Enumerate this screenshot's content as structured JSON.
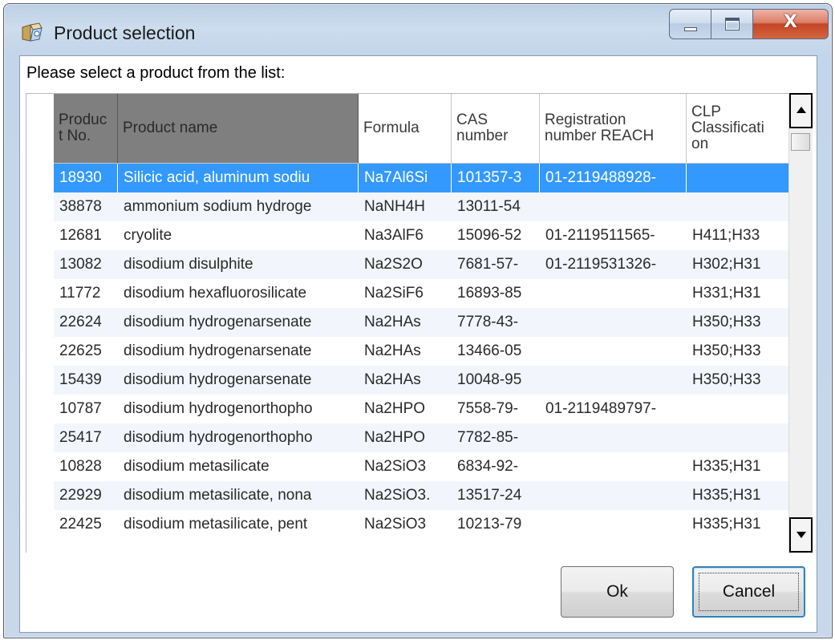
{
  "window": {
    "title": "Product selection",
    "icon": "app-icon",
    "caption": {
      "minimize_icon": "minimize-icon",
      "maximize_icon": "maximize-icon",
      "close_glyph": "X"
    }
  },
  "prompt": "Please select a product from the list:",
  "grid": {
    "columns": [
      "Product No.",
      "Product name",
      "Formula",
      "CAS number",
      "Registration number REACH",
      "CLP Classification"
    ],
    "header_display": [
      [
        "Produc",
        "t No."
      ],
      [
        "Product name"
      ],
      [
        "Formula"
      ],
      [
        "CAS",
        "number"
      ],
      [
        "Registration",
        "number REACH"
      ],
      [
        "CLP",
        "Classificati",
        "on"
      ]
    ],
    "selected_row": 0,
    "rows": [
      [
        "18930",
        "Silicic acid, aluminum sodiu",
        "Na7Al6Si",
        "101357-3",
        "01-2119488928-",
        ""
      ],
      [
        "38878",
        "ammonium sodium hydroge",
        "NaNH4H",
        "13011-54",
        "",
        ""
      ],
      [
        "12681",
        "cryolite",
        "Na3AlF6",
        "15096-52",
        "01-2119511565-",
        "H411;H33"
      ],
      [
        "13082",
        "disodium disulphite",
        "Na2S2O",
        "7681-57-",
        "01-2119531326-",
        "H302;H31"
      ],
      [
        "11772",
        "disodium hexafluorosilicate",
        "Na2SiF6",
        "16893-85",
        "",
        "H331;H31"
      ],
      [
        "22624",
        "disodium hydrogenarsenate",
        "Na2HAs",
        "7778-43-",
        "",
        "H350;H33"
      ],
      [
        "22625",
        "disodium hydrogenarsenate",
        "Na2HAs",
        "13466-05",
        "",
        "H350;H33"
      ],
      [
        "15439",
        "disodium hydrogenarsenate",
        "Na2HAs",
        "10048-95",
        "",
        "H350;H33"
      ],
      [
        "10787",
        "disodium hydrogenorthopho",
        "Na2HPO",
        "7558-79-",
        "01-2119489797-",
        ""
      ],
      [
        "25417",
        "disodium hydrogenorthopho",
        "Na2HPO",
        "7782-85-",
        "",
        ""
      ],
      [
        "10828",
        "disodium metasilicate",
        "Na2SiO3",
        "6834-92-",
        "",
        "H335;H31"
      ],
      [
        "22929",
        "disodium metasilicate, nona",
        "Na2SiO3.",
        "13517-24",
        "",
        "H335;H31"
      ],
      [
        "22425",
        "disodium metasilicate, pent",
        "Na2SiO3",
        "10213-79",
        "",
        "H335;H31"
      ]
    ],
    "scrollbar": {
      "up_icon": "scroll-up-arrow-icon",
      "down_icon": "scroll-down-arrow-icon"
    }
  },
  "buttons": {
    "ok_label": "Ok",
    "cancel_label": "Cancel",
    "focused": "cancel"
  },
  "colors": {
    "selection": "#3399ff",
    "selection_text": "#ffffff",
    "frozen_header": "#7f7f7f",
    "close_button": "#c44527",
    "focus_border": "#3c7fb1"
  }
}
